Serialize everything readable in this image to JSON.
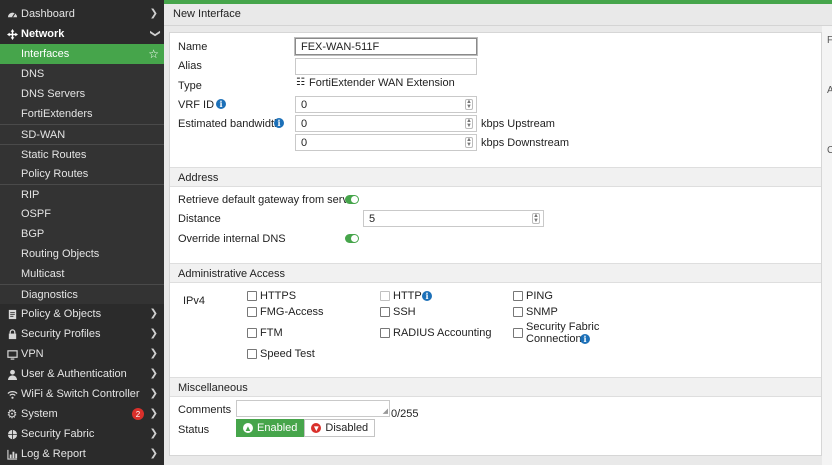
{
  "sidebar": {
    "dashboard": "Dashboard",
    "network": "Network",
    "interfaces": "Interfaces",
    "dns": "DNS",
    "dns_servers": "DNS Servers",
    "fortiextenders": "FortiExtenders",
    "sdwan": "SD-WAN",
    "static_routes": "Static Routes",
    "policy_routes": "Policy Routes",
    "rip": "RIP",
    "ospf": "OSPF",
    "bgp": "BGP",
    "routing_objects": "Routing Objects",
    "multicast": "Multicast",
    "diagnostics": "Diagnostics",
    "policy_objects": "Policy & Objects",
    "security_profiles": "Security Profiles",
    "vpn": "VPN",
    "user_auth": "User & Authentication",
    "wifi_switch": "WiFi & Switch Controller",
    "system": "System",
    "system_badge": "2",
    "security_fabric": "Security Fabric",
    "log_report": "Log & Report"
  },
  "page": {
    "title": "New Interface"
  },
  "form": {
    "name_label": "Name",
    "name_value": "FEX-WAN-511F",
    "alias_label": "Alias",
    "alias_value": "",
    "type_label": "Type",
    "type_value": "FortiExtender WAN Extension",
    "vrf_label": "VRF ID",
    "vrf_value": "0",
    "bandwidth_label": "Estimated bandwidth",
    "upstream_value": "0",
    "upstream_unit": "kbps Upstream",
    "downstream_value": "0",
    "downstream_unit": "kbps Downstream"
  },
  "address": {
    "section": "Address",
    "retrieve_gateway": "Retrieve default gateway from server",
    "distance_label": "Distance",
    "distance_value": "5",
    "override_dns": "Override internal DNS"
  },
  "admin_access": {
    "section": "Administrative Access",
    "ipv4_label": "IPv4",
    "https": "HTTPS",
    "http": "HTTP",
    "ping": "PING",
    "fmg_access": "FMG-Access",
    "ssh": "SSH",
    "snmp": "SNMP",
    "ftm": "FTM",
    "radius": "RADIUS Accounting",
    "fabric_line1": "Security Fabric",
    "fabric_line2": "Connection",
    "speed_test": "Speed Test"
  },
  "misc": {
    "section": "Miscellaneous",
    "comments_label": "Comments",
    "comments_counter": "0/255",
    "status_label": "Status",
    "enabled": "Enabled",
    "disabled": "Disabled"
  },
  "right_panel_chars": [
    "F",
    "A",
    "C"
  ],
  "colors": {
    "accent": "#46a54b",
    "sidebar_bg": "#2b2b2b",
    "info": "#1c70b8",
    "badge": "#d9302b"
  }
}
